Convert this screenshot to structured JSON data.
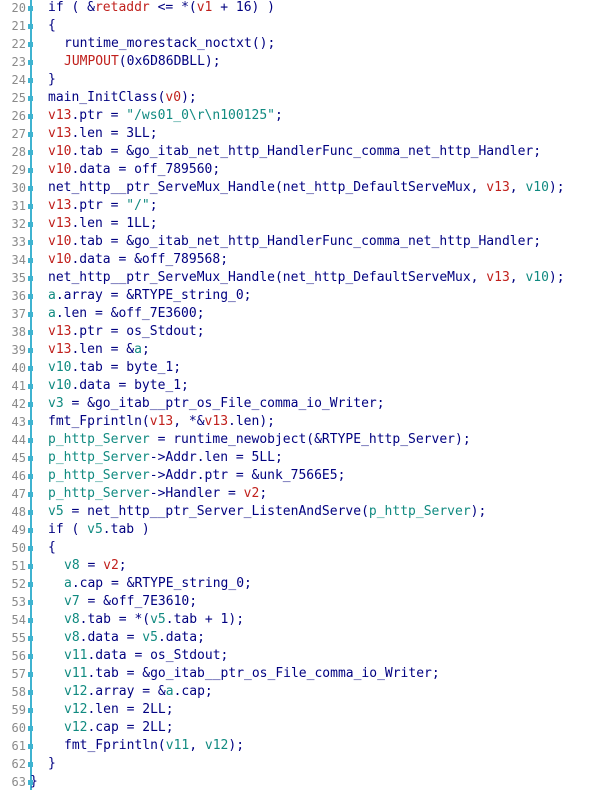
{
  "code_view": {
    "lines": [
      {
        "num": "20",
        "indent": 1,
        "tokens": [
          [
            "p",
            "if ( &"
          ],
          [
            "v",
            "retaddr"
          ],
          [
            "p",
            " <= *("
          ],
          [
            "v",
            "v1"
          ],
          [
            "p",
            " + 16) )"
          ]
        ]
      },
      {
        "num": "21",
        "indent": 1,
        "tokens": [
          [
            "p",
            "{"
          ]
        ]
      },
      {
        "num": "22",
        "indent": 2,
        "tokens": [
          [
            "p",
            "runtime_morestack_noctxt();"
          ]
        ]
      },
      {
        "num": "23",
        "indent": 2,
        "tokens": [
          [
            "f",
            "JUMPOUT"
          ],
          [
            "p",
            "(0x6D86DBLL);"
          ]
        ]
      },
      {
        "num": "24",
        "indent": 1,
        "tokens": [
          [
            "p",
            "}"
          ]
        ]
      },
      {
        "num": "25",
        "indent": 1,
        "tokens": [
          [
            "p",
            "main_InitClass("
          ],
          [
            "v",
            "v0"
          ],
          [
            "p",
            ");"
          ]
        ]
      },
      {
        "num": "26",
        "indent": 1,
        "tokens": [
          [
            "v",
            "v13"
          ],
          [
            "p",
            ".ptr = "
          ],
          [
            "s",
            "\"/ws01_0\\r\\n100125\""
          ],
          [
            "p",
            ";"
          ]
        ]
      },
      {
        "num": "27",
        "indent": 1,
        "tokens": [
          [
            "v",
            "v13"
          ],
          [
            "p",
            ".len = 3LL;"
          ]
        ]
      },
      {
        "num": "28",
        "indent": 1,
        "tokens": [
          [
            "v",
            "v10"
          ],
          [
            "p",
            ".tab = &go_itab_net_http_HandlerFunc_comma_net_http_Handler;"
          ]
        ]
      },
      {
        "num": "29",
        "indent": 1,
        "tokens": [
          [
            "v",
            "v10"
          ],
          [
            "p",
            ".data = off_789560;"
          ]
        ]
      },
      {
        "num": "30",
        "indent": 1,
        "tokens": [
          [
            "p",
            "net_http__ptr_ServeMux_Handle(net_http_DefaultServeMux, "
          ],
          [
            "v",
            "v13"
          ],
          [
            "p",
            ", "
          ],
          [
            "g",
            "v10"
          ],
          [
            "p",
            ");"
          ]
        ]
      },
      {
        "num": "31",
        "indent": 1,
        "tokens": [
          [
            "v",
            "v13"
          ],
          [
            "p",
            ".ptr = "
          ],
          [
            "s",
            "\"/\""
          ],
          [
            "p",
            ";"
          ]
        ]
      },
      {
        "num": "32",
        "indent": 1,
        "tokens": [
          [
            "v",
            "v13"
          ],
          [
            "p",
            ".len = 1LL;"
          ]
        ]
      },
      {
        "num": "33",
        "indent": 1,
        "tokens": [
          [
            "v",
            "v10"
          ],
          [
            "p",
            ".tab = &go_itab_net_http_HandlerFunc_comma_net_http_Handler;"
          ]
        ]
      },
      {
        "num": "34",
        "indent": 1,
        "tokens": [
          [
            "v",
            "v10"
          ],
          [
            "p",
            ".data = &off_789568;"
          ]
        ]
      },
      {
        "num": "35",
        "indent": 1,
        "tokens": [
          [
            "p",
            "net_http__ptr_ServeMux_Handle(net_http_DefaultServeMux, "
          ],
          [
            "v",
            "v13"
          ],
          [
            "p",
            ", "
          ],
          [
            "g",
            "v10"
          ],
          [
            "p",
            ");"
          ]
        ]
      },
      {
        "num": "36",
        "indent": 1,
        "tokens": [
          [
            "g",
            "a"
          ],
          [
            "p",
            ".array = &RTYPE_string_0;"
          ]
        ]
      },
      {
        "num": "37",
        "indent": 1,
        "tokens": [
          [
            "g",
            "a"
          ],
          [
            "p",
            ".len = &off_7E3600;"
          ]
        ]
      },
      {
        "num": "38",
        "indent": 1,
        "tokens": [
          [
            "v",
            "v13"
          ],
          [
            "p",
            ".ptr = os_Stdout;"
          ]
        ]
      },
      {
        "num": "39",
        "indent": 1,
        "tokens": [
          [
            "v",
            "v13"
          ],
          [
            "p",
            ".len = &"
          ],
          [
            "g",
            "a"
          ],
          [
            "p",
            ";"
          ]
        ]
      },
      {
        "num": "40",
        "indent": 1,
        "tokens": [
          [
            "g",
            "v10"
          ],
          [
            "p",
            ".tab = byte_1;"
          ]
        ]
      },
      {
        "num": "41",
        "indent": 1,
        "tokens": [
          [
            "g",
            "v10"
          ],
          [
            "p",
            ".data = byte_1;"
          ]
        ]
      },
      {
        "num": "42",
        "indent": 1,
        "tokens": [
          [
            "g",
            "v3"
          ],
          [
            "p",
            " = &go_itab__ptr_os_File_comma_io_Writer;"
          ]
        ]
      },
      {
        "num": "43",
        "indent": 1,
        "tokens": [
          [
            "p",
            "fmt_Fprintln("
          ],
          [
            "v",
            "v13"
          ],
          [
            "p",
            ", *&"
          ],
          [
            "v",
            "v13"
          ],
          [
            "p",
            ".len);"
          ]
        ]
      },
      {
        "num": "44",
        "indent": 1,
        "tokens": [
          [
            "g",
            "p_http_Server"
          ],
          [
            "p",
            " = runtime_newobject(&RTYPE_http_Server);"
          ]
        ]
      },
      {
        "num": "45",
        "indent": 1,
        "tokens": [
          [
            "g",
            "p_http_Server"
          ],
          [
            "p",
            "->Addr.len = 5LL;"
          ]
        ]
      },
      {
        "num": "46",
        "indent": 1,
        "tokens": [
          [
            "g",
            "p_http_Server"
          ],
          [
            "p",
            "->Addr.ptr = &unk_7566E5;"
          ]
        ]
      },
      {
        "num": "47",
        "indent": 1,
        "tokens": [
          [
            "g",
            "p_http_Server"
          ],
          [
            "p",
            "->Handler = "
          ],
          [
            "v",
            "v2"
          ],
          [
            "p",
            ";"
          ]
        ]
      },
      {
        "num": "48",
        "indent": 1,
        "tokens": [
          [
            "g",
            "v5"
          ],
          [
            "p",
            " = net_http__ptr_Server_ListenAndServe("
          ],
          [
            "g",
            "p_http_Server"
          ],
          [
            "p",
            ");"
          ]
        ]
      },
      {
        "num": "49",
        "indent": 1,
        "tokens": [
          [
            "p",
            "if ( "
          ],
          [
            "g",
            "v5"
          ],
          [
            "p",
            ".tab )"
          ]
        ]
      },
      {
        "num": "50",
        "indent": 1,
        "tokens": [
          [
            "p",
            "{"
          ]
        ]
      },
      {
        "num": "51",
        "indent": 2,
        "tokens": [
          [
            "g",
            "v8"
          ],
          [
            "p",
            " = "
          ],
          [
            "v",
            "v2"
          ],
          [
            "p",
            ";"
          ]
        ]
      },
      {
        "num": "52",
        "indent": 2,
        "tokens": [
          [
            "g",
            "a"
          ],
          [
            "p",
            ".cap = &RTYPE_string_0;"
          ]
        ]
      },
      {
        "num": "53",
        "indent": 2,
        "tokens": [
          [
            "g",
            "v7"
          ],
          [
            "p",
            " = &off_7E3610;"
          ]
        ]
      },
      {
        "num": "54",
        "indent": 2,
        "tokens": [
          [
            "g",
            "v8"
          ],
          [
            "p",
            ".tab = *("
          ],
          [
            "g",
            "v5"
          ],
          [
            "p",
            ".tab + 1);"
          ]
        ]
      },
      {
        "num": "55",
        "indent": 2,
        "tokens": [
          [
            "g",
            "v8"
          ],
          [
            "p",
            ".data = "
          ],
          [
            "g",
            "v5"
          ],
          [
            "p",
            ".data;"
          ]
        ]
      },
      {
        "num": "56",
        "indent": 2,
        "tokens": [
          [
            "g",
            "v11"
          ],
          [
            "p",
            ".data = os_Stdout;"
          ]
        ]
      },
      {
        "num": "57",
        "indent": 2,
        "tokens": [
          [
            "g",
            "v11"
          ],
          [
            "p",
            ".tab = &go_itab__ptr_os_File_comma_io_Writer;"
          ]
        ]
      },
      {
        "num": "58",
        "indent": 2,
        "tokens": [
          [
            "g",
            "v12"
          ],
          [
            "p",
            ".array = &"
          ],
          [
            "g",
            "a"
          ],
          [
            "p",
            ".cap;"
          ]
        ]
      },
      {
        "num": "59",
        "indent": 2,
        "tokens": [
          [
            "g",
            "v12"
          ],
          [
            "p",
            ".len = 2LL;"
          ]
        ]
      },
      {
        "num": "60",
        "indent": 2,
        "tokens": [
          [
            "g",
            "v12"
          ],
          [
            "p",
            ".cap = 2LL;"
          ]
        ]
      },
      {
        "num": "61",
        "indent": 2,
        "tokens": [
          [
            "p",
            "fmt_Fprintln("
          ],
          [
            "g",
            "v11"
          ],
          [
            "p",
            ", "
          ],
          [
            "g",
            "v12"
          ],
          [
            "p",
            ");"
          ]
        ]
      },
      {
        "num": "62",
        "indent": 1,
        "tokens": [
          [
            "p",
            "}"
          ]
        ]
      },
      {
        "num": "63",
        "indent": 0,
        "tokens": [
          [
            "p",
            "}"
          ]
        ]
      }
    ]
  },
  "colors": {
    "background": "#ffffff",
    "plain": "#000080",
    "variable": "#c0201c",
    "global": "#108a80",
    "gutter": "#8a8a8a",
    "marker": "#3fb3d0"
  }
}
